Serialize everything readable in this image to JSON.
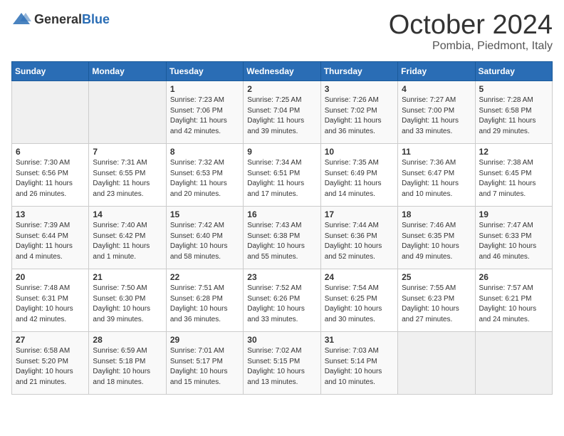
{
  "logo": {
    "general": "General",
    "blue": "Blue"
  },
  "header": {
    "month": "October 2024",
    "location": "Pombia, Piedmont, Italy"
  },
  "weekdays": [
    "Sunday",
    "Monday",
    "Tuesday",
    "Wednesday",
    "Thursday",
    "Friday",
    "Saturday"
  ],
  "weeks": [
    [
      {
        "day": "",
        "info": ""
      },
      {
        "day": "",
        "info": ""
      },
      {
        "day": "1",
        "info": "Sunrise: 7:23 AM\nSunset: 7:06 PM\nDaylight: 11 hours and 42 minutes."
      },
      {
        "day": "2",
        "info": "Sunrise: 7:25 AM\nSunset: 7:04 PM\nDaylight: 11 hours and 39 minutes."
      },
      {
        "day": "3",
        "info": "Sunrise: 7:26 AM\nSunset: 7:02 PM\nDaylight: 11 hours and 36 minutes."
      },
      {
        "day": "4",
        "info": "Sunrise: 7:27 AM\nSunset: 7:00 PM\nDaylight: 11 hours and 33 minutes."
      },
      {
        "day": "5",
        "info": "Sunrise: 7:28 AM\nSunset: 6:58 PM\nDaylight: 11 hours and 29 minutes."
      }
    ],
    [
      {
        "day": "6",
        "info": "Sunrise: 7:30 AM\nSunset: 6:56 PM\nDaylight: 11 hours and 26 minutes."
      },
      {
        "day": "7",
        "info": "Sunrise: 7:31 AM\nSunset: 6:55 PM\nDaylight: 11 hours and 23 minutes."
      },
      {
        "day": "8",
        "info": "Sunrise: 7:32 AM\nSunset: 6:53 PM\nDaylight: 11 hours and 20 minutes."
      },
      {
        "day": "9",
        "info": "Sunrise: 7:34 AM\nSunset: 6:51 PM\nDaylight: 11 hours and 17 minutes."
      },
      {
        "day": "10",
        "info": "Sunrise: 7:35 AM\nSunset: 6:49 PM\nDaylight: 11 hours and 14 minutes."
      },
      {
        "day": "11",
        "info": "Sunrise: 7:36 AM\nSunset: 6:47 PM\nDaylight: 11 hours and 10 minutes."
      },
      {
        "day": "12",
        "info": "Sunrise: 7:38 AM\nSunset: 6:45 PM\nDaylight: 11 hours and 7 minutes."
      }
    ],
    [
      {
        "day": "13",
        "info": "Sunrise: 7:39 AM\nSunset: 6:44 PM\nDaylight: 11 hours and 4 minutes."
      },
      {
        "day": "14",
        "info": "Sunrise: 7:40 AM\nSunset: 6:42 PM\nDaylight: 11 hours and 1 minute."
      },
      {
        "day": "15",
        "info": "Sunrise: 7:42 AM\nSunset: 6:40 PM\nDaylight: 10 hours and 58 minutes."
      },
      {
        "day": "16",
        "info": "Sunrise: 7:43 AM\nSunset: 6:38 PM\nDaylight: 10 hours and 55 minutes."
      },
      {
        "day": "17",
        "info": "Sunrise: 7:44 AM\nSunset: 6:36 PM\nDaylight: 10 hours and 52 minutes."
      },
      {
        "day": "18",
        "info": "Sunrise: 7:46 AM\nSunset: 6:35 PM\nDaylight: 10 hours and 49 minutes."
      },
      {
        "day": "19",
        "info": "Sunrise: 7:47 AM\nSunset: 6:33 PM\nDaylight: 10 hours and 46 minutes."
      }
    ],
    [
      {
        "day": "20",
        "info": "Sunrise: 7:48 AM\nSunset: 6:31 PM\nDaylight: 10 hours and 42 minutes."
      },
      {
        "day": "21",
        "info": "Sunrise: 7:50 AM\nSunset: 6:30 PM\nDaylight: 10 hours and 39 minutes."
      },
      {
        "day": "22",
        "info": "Sunrise: 7:51 AM\nSunset: 6:28 PM\nDaylight: 10 hours and 36 minutes."
      },
      {
        "day": "23",
        "info": "Sunrise: 7:52 AM\nSunset: 6:26 PM\nDaylight: 10 hours and 33 minutes."
      },
      {
        "day": "24",
        "info": "Sunrise: 7:54 AM\nSunset: 6:25 PM\nDaylight: 10 hours and 30 minutes."
      },
      {
        "day": "25",
        "info": "Sunrise: 7:55 AM\nSunset: 6:23 PM\nDaylight: 10 hours and 27 minutes."
      },
      {
        "day": "26",
        "info": "Sunrise: 7:57 AM\nSunset: 6:21 PM\nDaylight: 10 hours and 24 minutes."
      }
    ],
    [
      {
        "day": "27",
        "info": "Sunrise: 6:58 AM\nSunset: 5:20 PM\nDaylight: 10 hours and 21 minutes."
      },
      {
        "day": "28",
        "info": "Sunrise: 6:59 AM\nSunset: 5:18 PM\nDaylight: 10 hours and 18 minutes."
      },
      {
        "day": "29",
        "info": "Sunrise: 7:01 AM\nSunset: 5:17 PM\nDaylight: 10 hours and 15 minutes."
      },
      {
        "day": "30",
        "info": "Sunrise: 7:02 AM\nSunset: 5:15 PM\nDaylight: 10 hours and 13 minutes."
      },
      {
        "day": "31",
        "info": "Sunrise: 7:03 AM\nSunset: 5:14 PM\nDaylight: 10 hours and 10 minutes."
      },
      {
        "day": "",
        "info": ""
      },
      {
        "day": "",
        "info": ""
      }
    ]
  ]
}
